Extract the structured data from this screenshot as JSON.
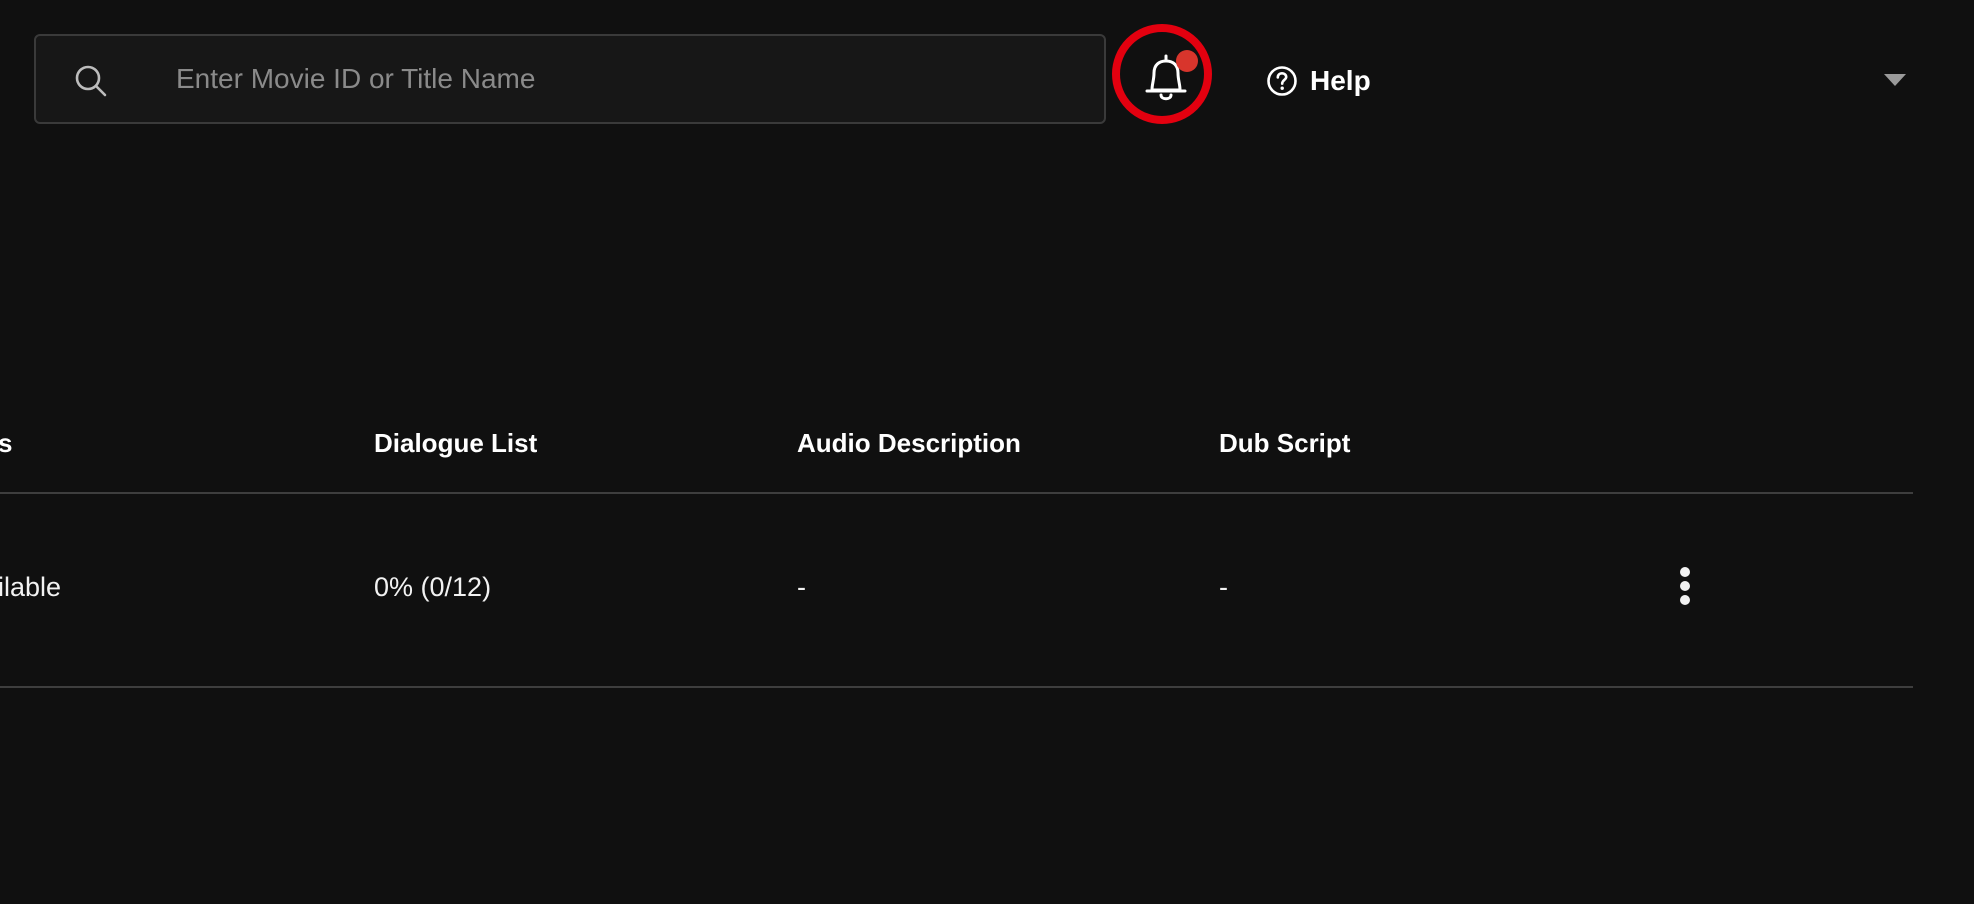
{
  "header": {
    "search": {
      "placeholder": "Enter Movie ID or Title Name",
      "value": ""
    },
    "notifications": {
      "icon": "bell-icon",
      "has_unread": true,
      "highlight_color": "#e3000f",
      "dot_color": "#d8352c"
    },
    "help": {
      "icon": "help-circle-icon",
      "label": "Help"
    },
    "account_menu": {
      "icon": "caret-down-icon"
    }
  },
  "table": {
    "columns": [
      "s",
      "Dialogue List",
      "Audio Description",
      "Dub Script"
    ],
    "rows": [
      {
        "cells": [
          "ilable",
          "0% (0/12)",
          "-",
          "-"
        ],
        "menu_icon": "more-vertical-icon"
      }
    ]
  },
  "colors": {
    "background": "#101010",
    "text": "#ffffff",
    "divider": "#3e3e3e",
    "placeholder": "#8a8a8a"
  }
}
